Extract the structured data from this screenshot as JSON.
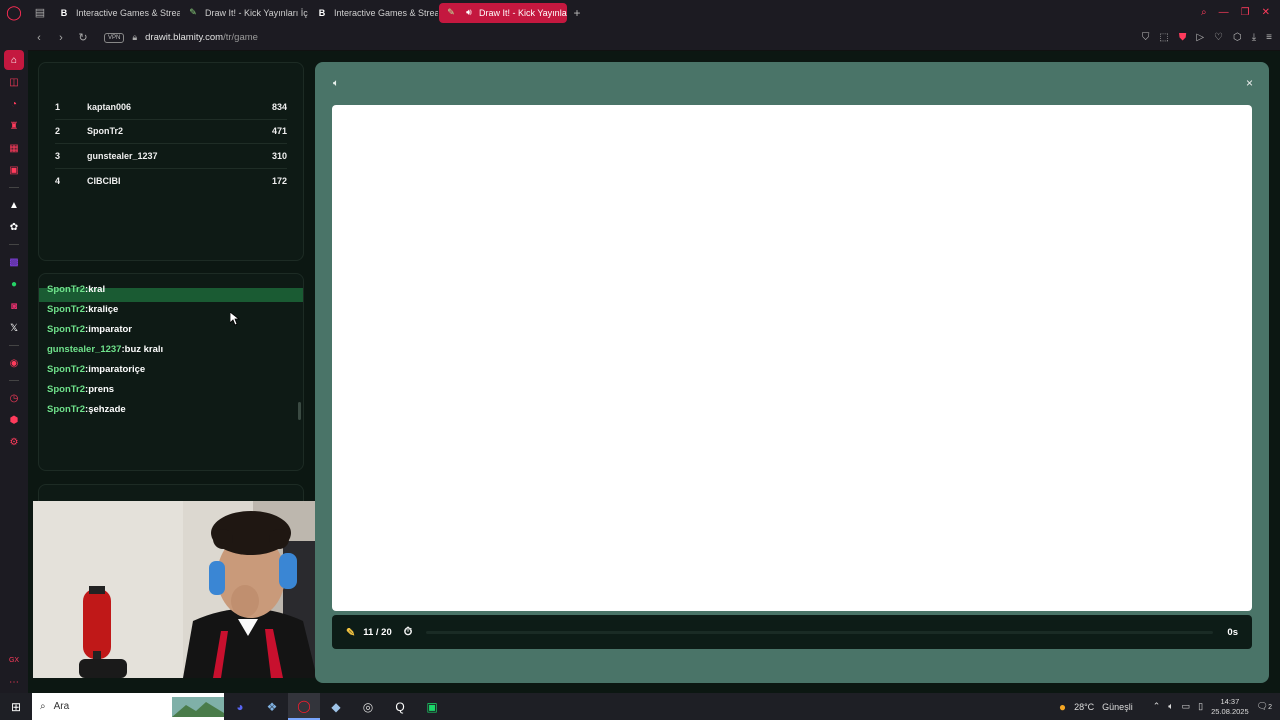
{
  "browser": {
    "tabs": [
      {
        "label": "Interactive Games & Strea",
        "icon": "blamity-icon"
      },
      {
        "label": "Draw It! - Kick Yayınları İç",
        "icon": "brush-icon"
      },
      {
        "label": "Interactive Games & Strea",
        "icon": "blamity-icon"
      },
      {
        "label": "Draw It! - Kick Yayınla",
        "icon": "speaker-icon",
        "active": true
      }
    ],
    "new_tab": "+",
    "vpn": "VPN",
    "url_host": "drawit.blamity.com",
    "url_path": "/tr/game"
  },
  "leaderboard": [
    {
      "rank": "1",
      "name": "kaptan006",
      "score": "834"
    },
    {
      "rank": "2",
      "name": "SponTr2",
      "score": "471"
    },
    {
      "rank": "3",
      "name": "gunstealer_1237",
      "score": "310"
    },
    {
      "rank": "4",
      "name": "CIBCIBI",
      "score": "172"
    }
  ],
  "chat": [
    {
      "user": "SponTr2",
      "sep": ":",
      "text": "kral"
    },
    {
      "user": "SponTr2",
      "sep": ":",
      "text": "kraliçe"
    },
    {
      "user": "SponTr2",
      "sep": ":",
      "text": "imparator"
    },
    {
      "user": "gunstealer_1237",
      "sep": ":",
      "text": "buz kralı"
    },
    {
      "user": "SponTr2",
      "sep": ":",
      "text": "imparatoriçe"
    },
    {
      "user": "SponTr2",
      "sep": ":",
      "text": "prens"
    },
    {
      "user": "SponTr2",
      "sep": ":",
      "text": "şehzade"
    }
  ],
  "game": {
    "round": "11 / 20",
    "timer": "0s",
    "progress": 0.0,
    "close": "×"
  },
  "taskbar": {
    "search_placeholder": "Ara",
    "weather_temp": "28°C",
    "weather_desc": "Güneşli",
    "time": "14:37",
    "date": "25.08.2025",
    "notifications": "2"
  },
  "colors": {
    "accent": "#c4183f",
    "chat_username": "#6fe28b",
    "game_bg": "#4a7468"
  }
}
